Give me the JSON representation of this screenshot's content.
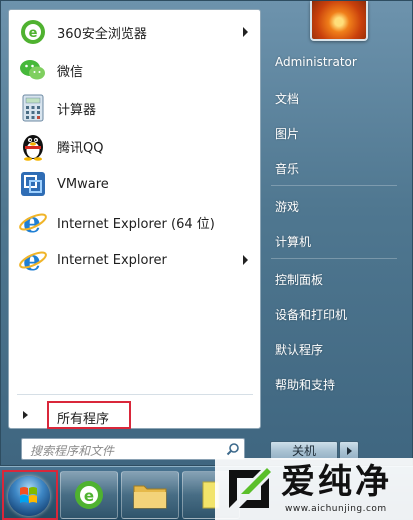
{
  "programs": [
    {
      "label": "360安全浏览器",
      "icon": "360-browser-icon",
      "has_submenu": true
    },
    {
      "label": "微信",
      "icon": "wechat-icon",
      "has_submenu": false
    },
    {
      "label": "计算器",
      "icon": "calculator-icon",
      "has_submenu": false
    },
    {
      "label": "腾讯QQ",
      "icon": "qq-penguin-icon",
      "has_submenu": false
    },
    {
      "label": "VMware",
      "icon": "vmware-icon",
      "has_submenu": false
    },
    {
      "label": "Internet Explorer (64 位)",
      "icon": "internet-explorer-icon",
      "has_submenu": false
    },
    {
      "label": "Internet Explorer",
      "icon": "internet-explorer-icon",
      "has_submenu": true
    }
  ],
  "all_programs": {
    "label": "所有程序"
  },
  "search": {
    "placeholder": "搜索程序和文件"
  },
  "right_menu": {
    "user": "Administrator",
    "items": [
      "文档",
      "图片",
      "音乐",
      "游戏",
      "计算机",
      "控制面板",
      "设备和打印机",
      "默认程序",
      "帮助和支持"
    ]
  },
  "shutdown": {
    "label": "关机"
  },
  "watermark": {
    "title": "爱纯净",
    "url": "www.aichunjing.com"
  },
  "colors": {
    "highlight_box": "#d9273a",
    "menu_blue": "#4f7790"
  }
}
